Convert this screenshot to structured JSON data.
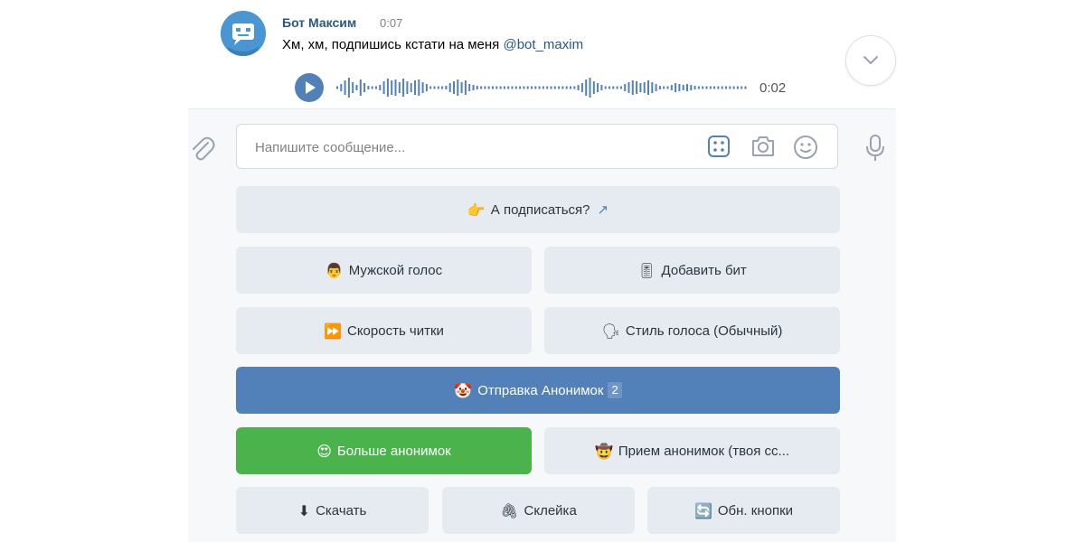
{
  "message": {
    "author": "Бот Максим",
    "time": "0:07",
    "text": "Хм, хм, подпишись кстати на меня",
    "mention": "@bot_maxim",
    "voice_duration": "0:02"
  },
  "composer": {
    "placeholder": "Напишите сообщение..."
  },
  "keyboard": {
    "subscribe": {
      "emoji": "👉",
      "label": "А подписаться?",
      "arrow": "↗"
    },
    "male_voice": {
      "emoji": "👨",
      "label": "Мужской голос"
    },
    "add_beat": {
      "emoji": "🎚",
      "label": "Добавить бит"
    },
    "read_speed": {
      "emoji": "⏩",
      "label": "Скорость читки"
    },
    "voice_style": {
      "emoji": "🗣",
      "label": "Стиль голоса (Обычный)"
    },
    "send_anon": {
      "emoji": "🤡",
      "label": "Отправка Анонимок",
      "badge": "2"
    },
    "more_anon": {
      "emoji": "😍",
      "label": "Больше анонимок"
    },
    "receive_anon": {
      "emoji": "🤠",
      "label": "Прием анонимок (твоя сс..."
    },
    "download": {
      "emoji": "⬇",
      "label": "Скачать"
    },
    "glue": {
      "emoji": "🖇",
      "label": "Склейка"
    },
    "refresh": {
      "emoji": "🔄",
      "label": "Обн. кнопки"
    }
  },
  "colors": {
    "accent": "#5181b8",
    "positive": "#4bb34b",
    "secondary_btn": "#e5ebf1",
    "link": "#2a5885"
  },
  "icons": [
    "bot-avatar-icon",
    "play-icon",
    "chevron-down-icon",
    "paperclip-icon",
    "keyboard-icon",
    "camera-icon",
    "smile-icon",
    "microphone-icon"
  ]
}
